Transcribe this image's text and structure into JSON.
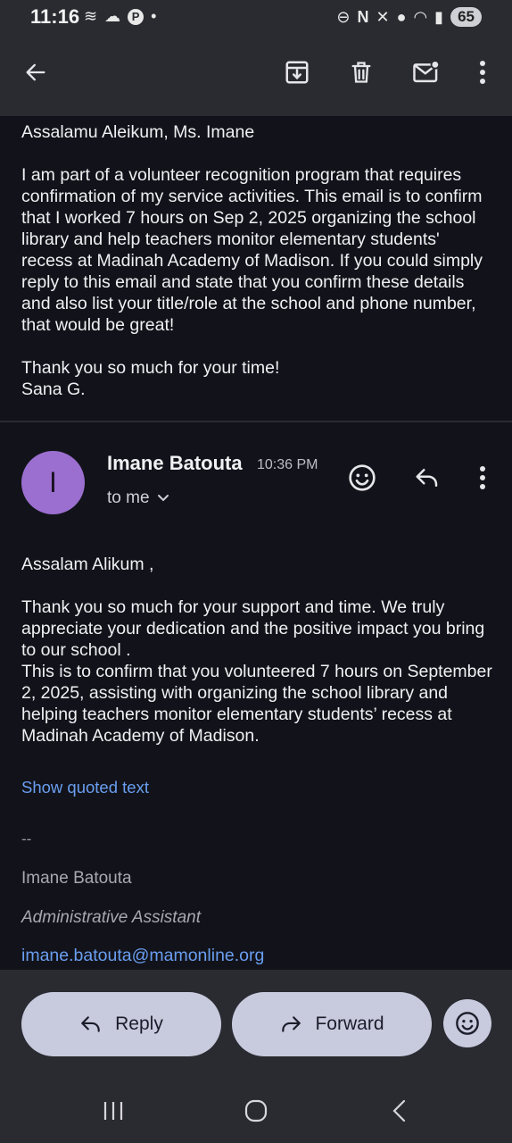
{
  "status_bar": {
    "time": "11:16",
    "battery": "65"
  },
  "toolbar": {
    "back_icon": "arrow-left-icon",
    "archive_icon": "archive-icon",
    "delete_icon": "trash-icon",
    "mark_unread_icon": "mail-unread-icon",
    "more_icon": "more-vertical-icon"
  },
  "message1": {
    "greeting": "Assalamu Aleikum, Ms. Imane",
    "body": "I am part of a volunteer recognition program that requires confirmation of my service activities. This email is to confirm that I worked 7 hours on Sep 2, 2025 organizing the school library and help teachers monitor elementary students' recess at Madinah Academy of Madison. If you could simply reply to this email and state that you confirm these details and also list your title/role at the school and phone number, that would be great!",
    "closing": "Thank you so much for your time!",
    "signature": "Sana G."
  },
  "message2": {
    "avatar_letter": "I",
    "avatar_color": "#9b6fd0",
    "sender": "Imane Batouta",
    "time": "10:36 PM",
    "recipient": "to me",
    "greeting": "Assalam Alikum ,",
    "paragraph1": "Thank you so much for your support and time. We truly appreciate your dedication and the positive impact you bring to our school .",
    "paragraph2": "This is to confirm that you volunteered 7 hours on September 2, 2025, assisting with organizing the school library and helping teachers monitor elementary students’ recess at Madinah Academy of Madison.",
    "show_quoted": "Show quoted text",
    "sig_separator": "--",
    "sig_name": "Imane Batouta",
    "sig_title": "Administrative Assistant",
    "sig_email": "imane.batouta@mamonline.org"
  },
  "actions": {
    "reply": "Reply",
    "forward": "Forward",
    "emoji_icon": "emoji-smile-icon"
  },
  "colors": {
    "background": "#12131a",
    "surface": "#2a2b31",
    "accent_link": "#6a9ef0",
    "pill": "#c8cade"
  }
}
